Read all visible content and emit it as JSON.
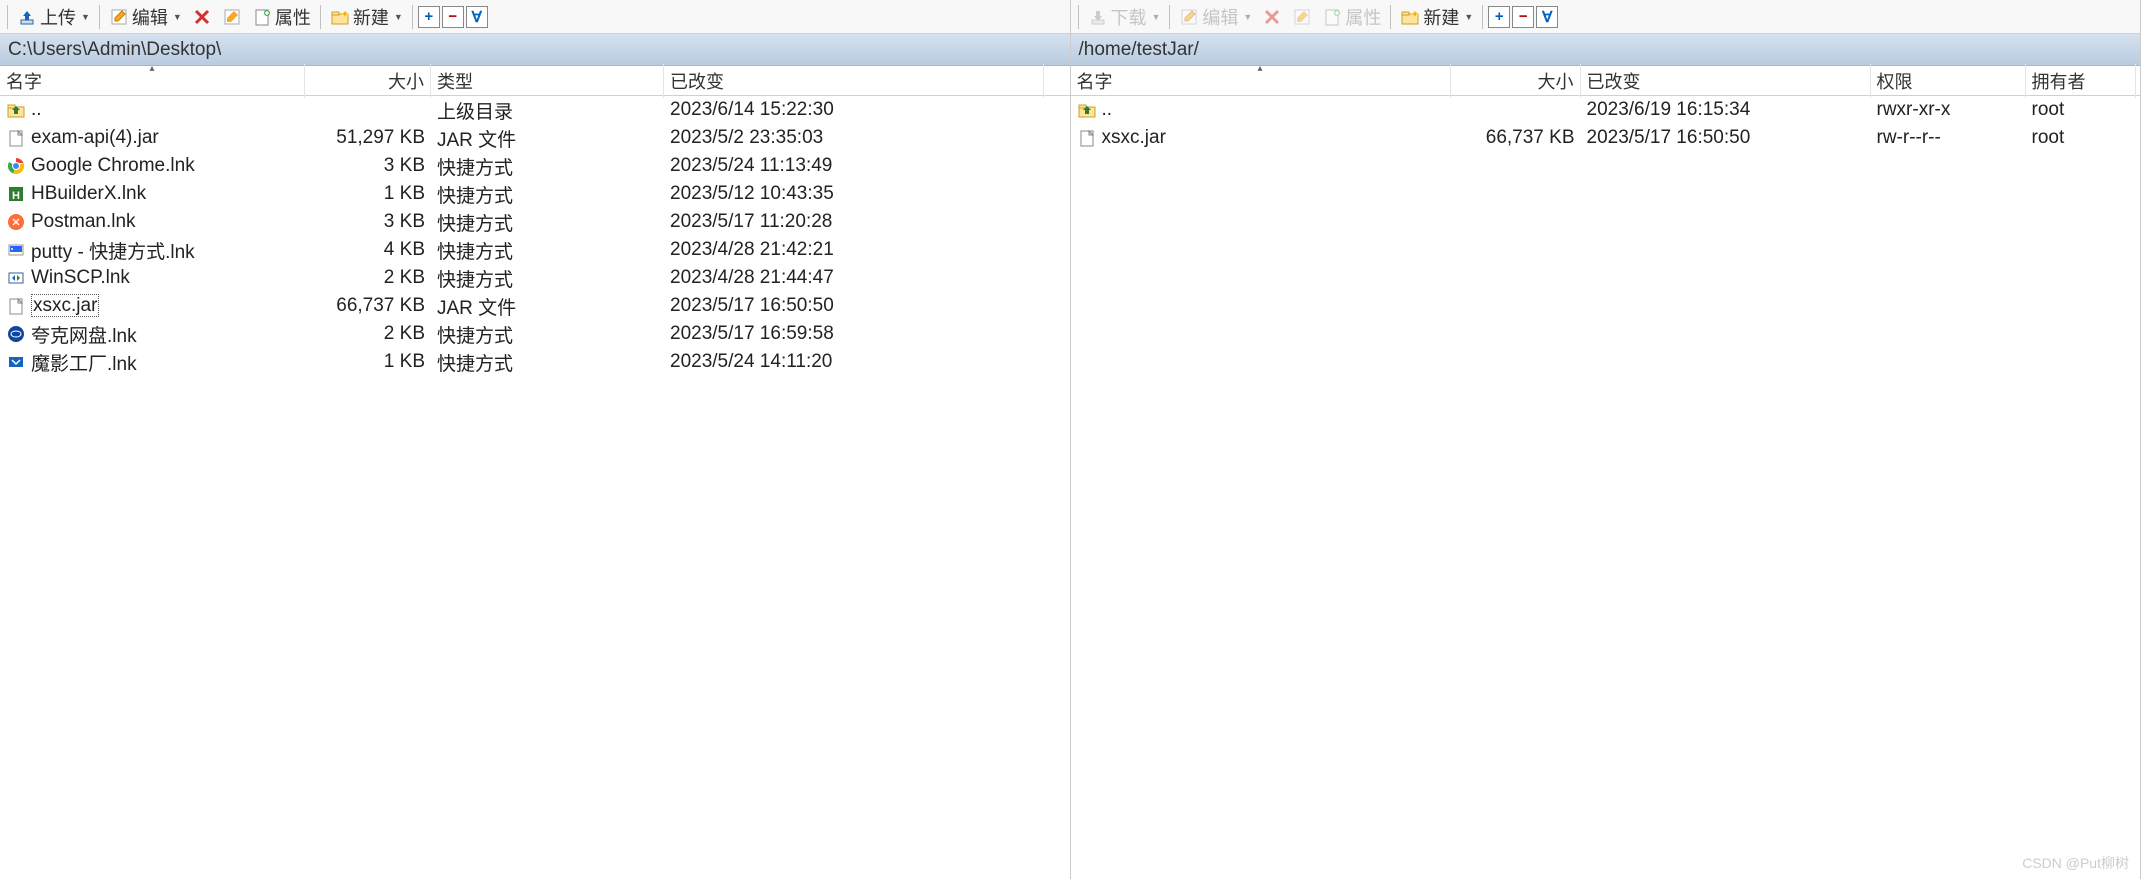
{
  "left": {
    "toolbar": {
      "upload": "上传",
      "edit": "编辑",
      "props": "属性",
      "new": "新建"
    },
    "path": "C:\\Users\\Admin\\Desktop\\",
    "headers": {
      "name": "名字",
      "size": "大小",
      "type": "类型",
      "changed": "已改变"
    },
    "rows": [
      {
        "icon": "folder-up",
        "name": "..",
        "size": "",
        "type": "上级目录",
        "changed": "2023/6/14  15:22:30",
        "sel": false
      },
      {
        "icon": "file",
        "name": "exam-api(4).jar",
        "size": "51,297 KB",
        "type": "JAR 文件",
        "changed": "2023/5/2  23:35:03",
        "sel": false
      },
      {
        "icon": "chrome",
        "name": "Google Chrome.lnk",
        "size": "3 KB",
        "type": "快捷方式",
        "changed": "2023/5/24  11:13:49",
        "sel": false
      },
      {
        "icon": "hbuilder",
        "name": "HBuilderX.lnk",
        "size": "1 KB",
        "type": "快捷方式",
        "changed": "2023/5/12  10:43:35",
        "sel": false
      },
      {
        "icon": "postman",
        "name": "Postman.lnk",
        "size": "3 KB",
        "type": "快捷方式",
        "changed": "2023/5/17  11:20:28",
        "sel": false
      },
      {
        "icon": "putty",
        "name": "putty - 快捷方式.lnk",
        "size": "4 KB",
        "type": "快捷方式",
        "changed": "2023/4/28  21:42:21",
        "sel": false
      },
      {
        "icon": "winscp",
        "name": "WinSCP.lnk",
        "size": "2 KB",
        "type": "快捷方式",
        "changed": "2023/4/28  21:44:47",
        "sel": false
      },
      {
        "icon": "file",
        "name": "xsxc.jar",
        "size": "66,737 KB",
        "type": "JAR 文件",
        "changed": "2023/5/17  16:50:50",
        "sel": true
      },
      {
        "icon": "quark",
        "name": "夸克网盘.lnk",
        "size": "2 KB",
        "type": "快捷方式",
        "changed": "2023/5/17  16:59:58",
        "sel": false
      },
      {
        "icon": "moying",
        "name": "魔影工厂.lnk",
        "size": "1 KB",
        "type": "快捷方式",
        "changed": "2023/5/24  14:11:20",
        "sel": false
      }
    ]
  },
  "right": {
    "toolbar": {
      "download": "下载",
      "edit": "编辑",
      "props": "属性",
      "new": "新建"
    },
    "path": "/home/testJar/",
    "headers": {
      "name": "名字",
      "size": "大小",
      "changed": "已改变",
      "perm": "权限",
      "owner": "拥有者"
    },
    "rows": [
      {
        "icon": "folder-up",
        "name": "..",
        "size": "",
        "changed": "2023/6/19 16:15:34",
        "perm": "rwxr-xr-x",
        "owner": "root"
      },
      {
        "icon": "file",
        "name": "xsxc.jar",
        "size": "66,737 KB",
        "changed": "2023/5/17 16:50:50",
        "perm": "rw-r--r--",
        "owner": "root"
      }
    ]
  },
  "watermark": "CSDN @Put柳树"
}
